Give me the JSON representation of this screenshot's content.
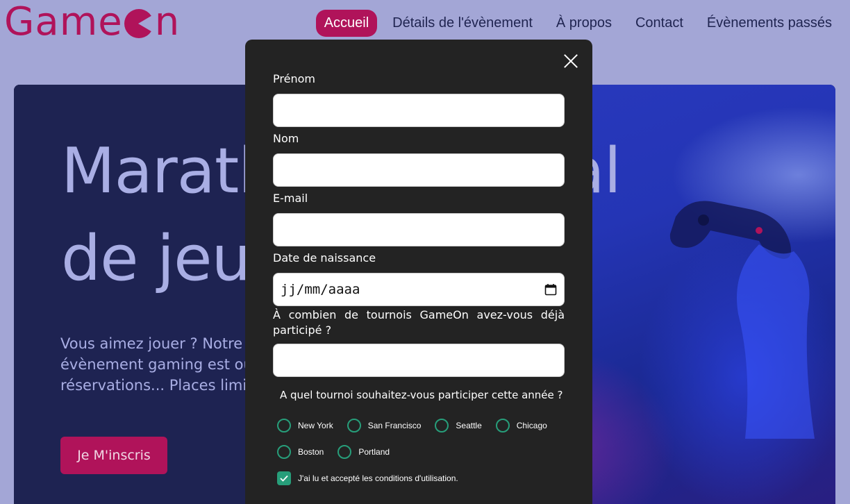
{
  "brand": {
    "name": "GameOn",
    "left": "Game",
    "right": "n",
    "color": "#b0135a"
  },
  "nav": {
    "items": [
      {
        "label": "Accueil",
        "active": true
      },
      {
        "label": "Détails de l'évènement"
      },
      {
        "label": "À propos"
      },
      {
        "label": "Contact"
      },
      {
        "label": "Évènements passés"
      }
    ]
  },
  "hero": {
    "title_line1": "Marathon national",
    "title_line2": "de jeux vidéos",
    "text_line1": "Vous aimez jouer ? Notre prochain",
    "text_line2": "évènement gaming est ouvert aux",
    "text_line3": "réservations... Places limitées !",
    "cta_label": "Je M'inscris"
  },
  "form": {
    "first_name_label": "Prénom",
    "first_name_value": "",
    "last_name_label": "Nom",
    "last_name_value": "",
    "email_label": "E-mail",
    "email_value": "",
    "birthdate_label": "Date de naissance",
    "birthdate_placeholder": "jj/mm/aaaa",
    "tournaments_question": "À combien de tournois GameOn avez-vous déjà participé ?",
    "tournaments_value": "",
    "location_question": "A quel tournoi souhaitez-vous participer cette année ?",
    "locations": [
      "New York",
      "San Francisco",
      "Seattle",
      "Chicago",
      "Boston",
      "Portland"
    ],
    "terms_label": "J'ai lu et accepté les conditions d'utilisation.",
    "terms_checked": true,
    "accent_color": "#279e7a"
  },
  "icons": {
    "close": "close-icon",
    "calendar": "calendar-icon",
    "check": "check-icon"
  }
}
